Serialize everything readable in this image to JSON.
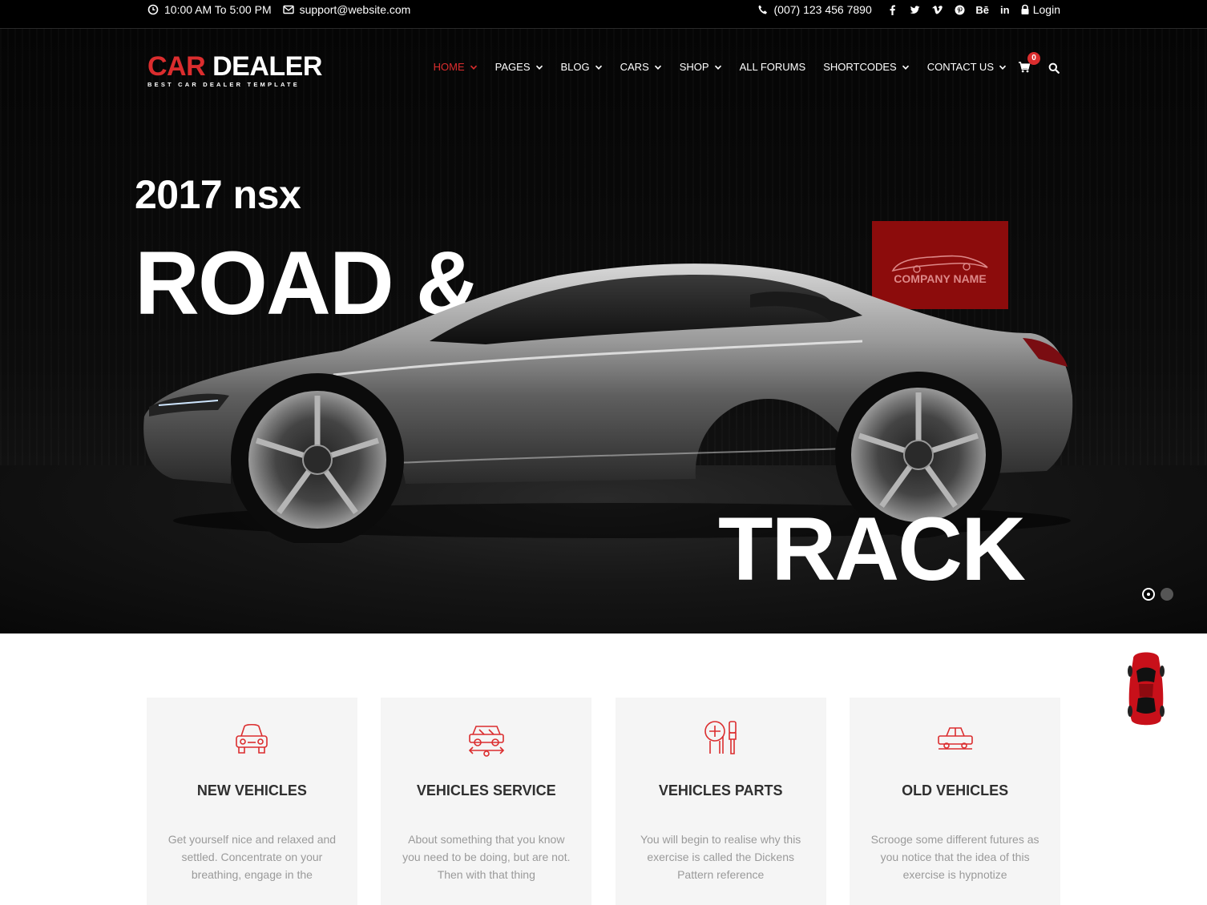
{
  "topbar": {
    "hours": "10:00 AM To 5:00 PM",
    "email": "support@website.com",
    "phone": "(007) 123 456 7890",
    "social": [
      "facebook-icon",
      "twitter-icon",
      "vimeo-icon",
      "pinterest-icon",
      "behance-icon",
      "linkedin-icon"
    ],
    "behance_label": "Bē",
    "linkedin_label": "in",
    "login_label": "Login"
  },
  "brand": {
    "logo_part1": "CAR",
    "logo_part2": "DEALER",
    "tagline": "BEST CAR DEALER TEMPLATE",
    "accent_color": "#db2d2e"
  },
  "nav": {
    "items": [
      {
        "label": "HOME",
        "has_dropdown": true,
        "active": true
      },
      {
        "label": "PAGES",
        "has_dropdown": true
      },
      {
        "label": "BLOG",
        "has_dropdown": true
      },
      {
        "label": "CARS",
        "has_dropdown": true
      },
      {
        "label": "SHOP",
        "has_dropdown": true
      },
      {
        "label": "ALL FORUMS",
        "has_dropdown": false
      },
      {
        "label": "SHORTCODES",
        "has_dropdown": true
      },
      {
        "label": "CONTACT US",
        "has_dropdown": true
      }
    ],
    "cart_count": "0"
  },
  "slider": {
    "year_model": "2017 nsx",
    "headline_1": "ROAD &",
    "headline_2": "TRACK",
    "company_label": "COMPANY NAME",
    "slide_count": 2,
    "active_slide": 1
  },
  "features": [
    {
      "icon": "new-vehicle-icon",
      "title": "NEW VEHICLES",
      "text": "Get yourself nice and relaxed and settled. Concentrate on your breathing, engage in the"
    },
    {
      "icon": "vehicle-service-icon",
      "title": "VEHICLES SERVICE",
      "text": "About something that you know you need to be doing, but are not. Then with that thing"
    },
    {
      "icon": "vehicle-parts-icon",
      "title": "VEHICLES PARTS",
      "text": "You will begin to realise why this exercise is called the Dickens Pattern reference"
    },
    {
      "icon": "old-vehicle-icon",
      "title": "OLD VEHICLES",
      "text": "Scrooge some different futures as you notice that the idea of this exercise is hypnotize"
    }
  ]
}
